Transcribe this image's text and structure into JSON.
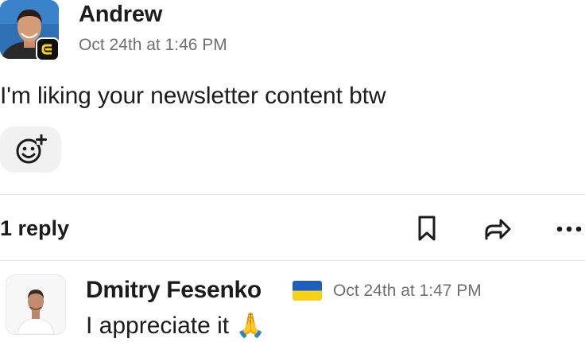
{
  "message": {
    "author": "Andrew",
    "timestamp": "Oct 24th at 1:46 PM",
    "text": "I'm liking your newsletter content btw",
    "avatar_icon": "user-photo",
    "app_badge_icon": "app-badge-c"
  },
  "reactions": {
    "add_icon": "add-reaction-icon"
  },
  "thread": {
    "reply_count_label": "1 reply",
    "actions": [
      "bookmark-icon",
      "share-icon",
      "more-icon"
    ]
  },
  "reply": {
    "author": "Dmitry Fesenko",
    "status_emoji": "ukraine-flag",
    "timestamp": "Oct 24th at 1:47 PM",
    "text": "I appreciate it",
    "text_emoji": "🙏",
    "colors": {
      "flag_blue": "#1f5fbf",
      "flag_yellow": "#f7d117"
    }
  }
}
